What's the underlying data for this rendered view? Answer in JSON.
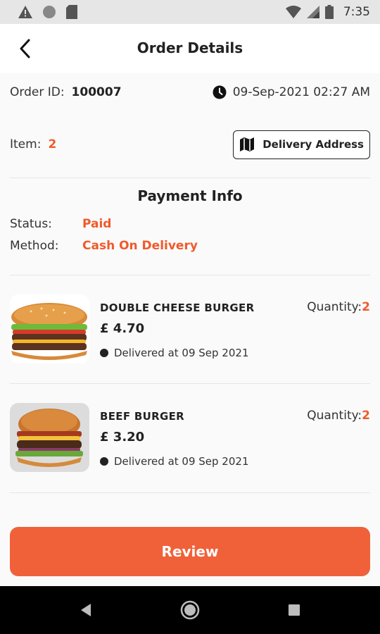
{
  "status_bar": {
    "time": "7:35"
  },
  "header": {
    "title": "Order Details"
  },
  "order": {
    "id_label": "Order ID:",
    "id": "100007",
    "date": "09-Sep-2021 02:27 AM",
    "items_label": "Item:",
    "items_count": "2",
    "delivery_button": "Delivery Address"
  },
  "payment": {
    "title": "Payment Info",
    "status_label": "Status:",
    "status": "Paid",
    "method_label": "Method:",
    "method": "Cash On Delivery"
  },
  "products": [
    {
      "name": "DOUBLE CHEESE BURGER",
      "price": "£ 4.70",
      "quantity_label": "Quantity:",
      "quantity": "2",
      "status": "Delivered at 09 Sep 2021"
    },
    {
      "name": "BEEF BURGER",
      "price": "£ 3.20",
      "quantity_label": "Quantity:",
      "quantity": "2",
      "status": "Delivered at 09 Sep 2021"
    }
  ],
  "review_button": "Review",
  "colors": {
    "accent": "#f05a2b",
    "button": "#f0613a"
  },
  "icons": {
    "back": "arrow-back-icon",
    "clock": "clock-icon",
    "map": "map-icon",
    "nav_back": "triangle-back-icon",
    "nav_home": "circle-home-icon",
    "nav_recent": "square-recent-icon"
  }
}
